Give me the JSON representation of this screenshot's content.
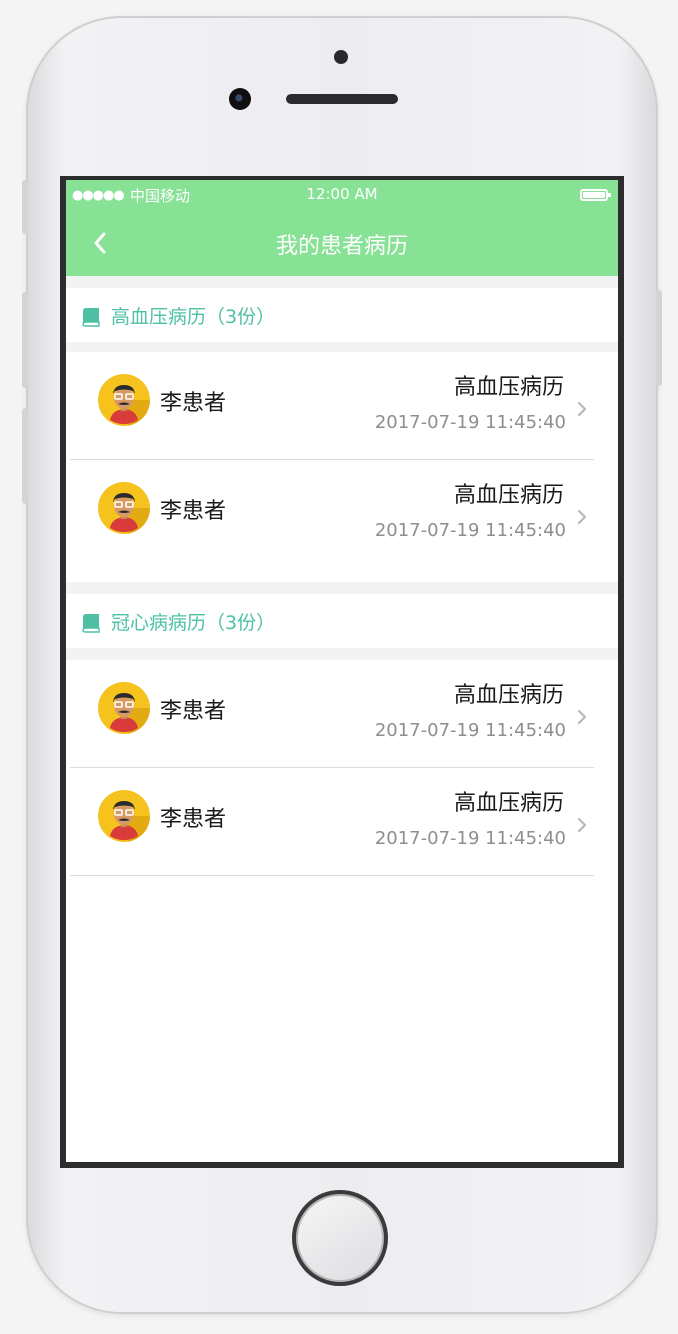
{
  "status_bar": {
    "signal": "●●●●●",
    "carrier": "中国移动",
    "time": "12:00 AM"
  },
  "nav": {
    "title": "我的患者病历",
    "back_icon": "chevron-left-icon"
  },
  "colors": {
    "header": "#87e296",
    "section_text": "#4ec1a5",
    "date_text": "#8e8e8e"
  },
  "sections": [
    {
      "label": "高血压病历（3份）",
      "icon": "book-icon",
      "records": [
        {
          "name": "李患者",
          "title": "高血压病历",
          "date": "2017-07-19 11:45:40"
        },
        {
          "name": "李患者",
          "title": "高血压病历",
          "date": "2017-07-19 11:45:40"
        }
      ]
    },
    {
      "label": "冠心病病历（3份）",
      "icon": "book-icon",
      "records": [
        {
          "name": "李患者",
          "title": "高血压病历",
          "date": "2017-07-19 11:45:40"
        },
        {
          "name": "李患者",
          "title": "高血压病历",
          "date": "2017-07-19 11:45:40"
        }
      ]
    }
  ]
}
